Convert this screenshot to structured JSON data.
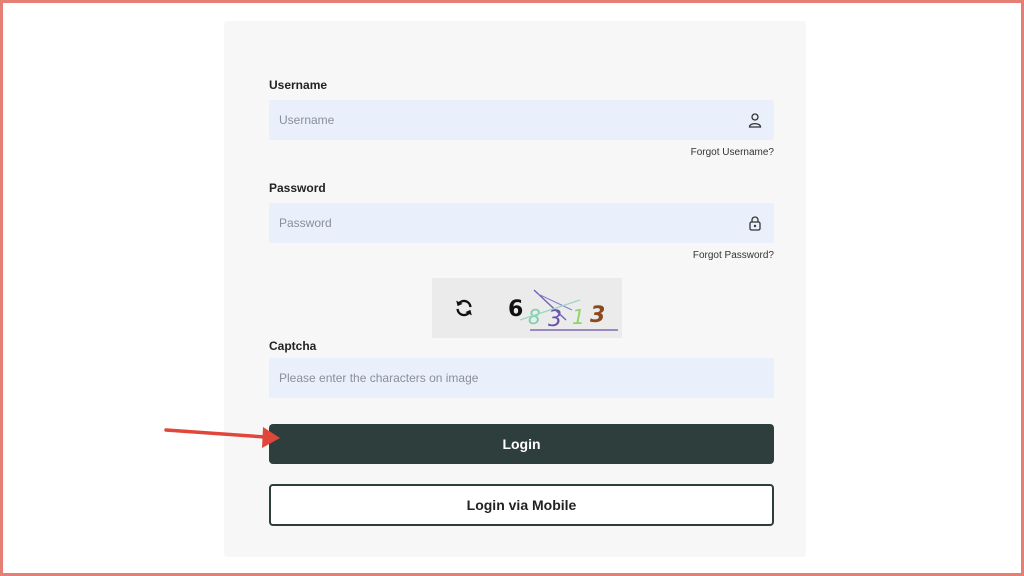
{
  "form": {
    "username_label": "Username",
    "username_placeholder": "Username",
    "forgot_username": "Forgot Username?",
    "password_label": "Password",
    "password_placeholder": "Password",
    "forgot_password": "Forgot Password?",
    "captcha_label": "Captcha",
    "captcha_placeholder": "Please enter the characters on image",
    "captcha_chars": [
      "6",
      "8",
      "3",
      "1",
      "3"
    ],
    "login_button": "Login",
    "mobile_login_button": "Login via Mobile"
  },
  "icons": {
    "username_field": "user-icon",
    "password_field": "lock-icon",
    "captcha_refresh": "refresh-icon",
    "annotation": "red-arrow-icon"
  },
  "colors": {
    "frame_border": "#e57f73",
    "panel_bg": "#f7f7f7",
    "field_bg": "#e9f0fb",
    "primary_button": "#2e3e3c",
    "arrow": "#e0463a"
  }
}
